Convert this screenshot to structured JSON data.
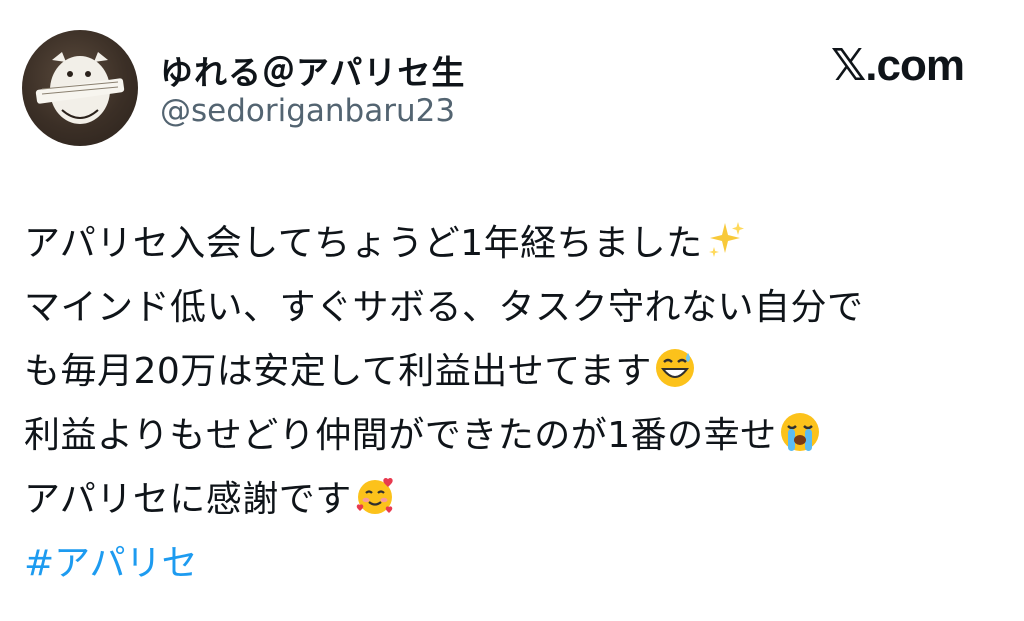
{
  "author": {
    "display_name": "ゆれる＠アパリセ生",
    "handle": "@sedoriganbaru23",
    "avatar_icon": "avatar-illustration-icon"
  },
  "brand": {
    "label": "𝕏.com"
  },
  "tweet": {
    "lines": [
      {
        "text": "アパリセ入会してちょうど1年経ちました",
        "emoji": "sparkles-emoji"
      },
      {
        "text": "マインド低い、すぐサボる、タスク守れない自分で",
        "emoji": ""
      },
      {
        "text": "も毎月20万は安定して利益出せてます",
        "emoji": "grinning-sweat-emoji"
      },
      {
        "text": "利益よりもせどり仲間ができたのが1番の幸せ",
        "emoji": "loudly-crying-emoji"
      },
      {
        "text": "アパリセに感謝です",
        "emoji": "smiling-hearts-emoji"
      }
    ],
    "hashtag": "#アパリセ"
  },
  "colors": {
    "text": "#0f1419",
    "secondary": "#536471",
    "link": "#1d9bf0",
    "background": "#ffffff"
  }
}
